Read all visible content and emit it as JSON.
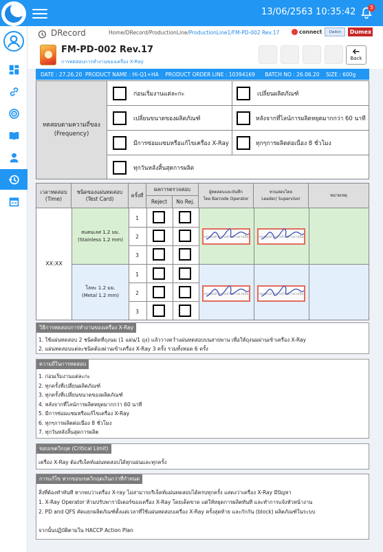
{
  "topbar": {
    "datetime": "13/06/2563 10:35:42",
    "notification_count": "5"
  },
  "header": {
    "brand": "DRecord",
    "breadcrumb_prefix": "Home/DRecord/ProductionLine/",
    "breadcrumb_current": "ProductionLine1/FM-PD-002 Rev.17",
    "partner_connect": "connect",
    "partner_daikin": "Daikin",
    "partner_dumex": "Dumex",
    "doc_title": "FM-PD-002 Rev.17",
    "doc_subtitle": "การทดสอบการทำงานของเครื่อง X-Ray",
    "back_label": "Back"
  },
  "infobar": {
    "date_label": "DATE :",
    "date": "27.26.20",
    "product_name_label": "PRODUCT NAME :",
    "product_name": "Hi-Q1+HA",
    "order_line_label": "PRODUCT ORDER LINE :",
    "order_line": "10394169",
    "batch_label": "BATCH NO :",
    "batch": "26.06.20",
    "size_label": "SIZE :",
    "size": "600g"
  },
  "frequency": {
    "label_th": "ทดสอบตามความถี่ของ",
    "label_en": "(Frequency)",
    "options": [
      "ก่อนเริ่มงานแต่ละกะ",
      "เปลี่ยนผลิตภัณฑ์",
      "เปลี่ยนขนาดของผลิตภัณฑ์",
      "หลังจากที่ไลน์การผลิตหยุดมากกว่า 60 นาที",
      "มีการซ่อมแซมหรือแก้ไขเครื่อง X-Ray",
      "ทุกๆการผลิตต่อเนื่อง 8  ชั่วโมง",
      "ทุกวันหลังสิ้นสุดการผลิต"
    ]
  },
  "table": {
    "headers": {
      "time_th": "เวลาทดสอบ",
      "time_en": "(Time)",
      "card_th": "ชนิดของแผ่นทดสอบ",
      "card_en": "(Test Card)",
      "round": "ครั้งที่",
      "result": "ผลการตรวจสอบ",
      "reject": "Reject",
      "no_rej": "No Rej.",
      "operator_th": "ผู้ทดสอบและบันทึก",
      "operator_en": "โดย Barcode Operator",
      "reviewer_th": "ทวนสอบโดย",
      "reviewer_en": "Leader/ Supervisor",
      "remark": "หมายเหตุ"
    },
    "time_value": "XX:XX",
    "groups": [
      {
        "card_th": "สแตนเลส 1.2 มม.",
        "card_en": "(Stainless 1.2 mm)",
        "rounds": [
          "1",
          "2",
          "3"
        ]
      },
      {
        "card_th": "โลหะ 1.2 มม.",
        "card_en": "(Metal 1.2 mm)",
        "rounds": [
          "1",
          "2",
          "3"
        ]
      }
    ],
    "stamp_text": "ทดสอบตัวอย่างตัวอย่างลายมือ"
  },
  "sections": {
    "method": {
      "title": "วิธีการทดสอบการทำงานของเครื่อง X-Ray",
      "lines": [
        "1. ใช้แผ่นทดสอบ 2 ชนิดติดที่ถุงนม (1 แผ่น/1 ถุง) แล้ววางคว่ำแผ่นทดสอบบนสายพาน เพื่อให้ถุงนมผ่านเข้าเครื่อง X-Ray",
        "2. แผ่นทดสอบแต่ละชนิดต้องผ่านเข้าเครื่อง X-Ray 3 ครั้ง รวมทั้งหมด 6 ครั้ง"
      ]
    },
    "frequency_detail": {
      "title": "ความถี่ในการทดสอบ",
      "lines": [
        "1. ก่อนเริ่มงานแต่ละกะ",
        "2. ทุกครั้งที่เปลี่ยนผลิตภัณฑ์",
        "3. ทุกครั้งที่เปลี่ยนขนาดของผลิตภัณฑ์",
        "4. หลังจากที่ไลน์การผลิตหยุดมากกว่า 60 นาที",
        "5. มีการซ่อมแซมหรือแก้ไขเครื่อง X-Ray",
        "6. ทุกๆการผลิตต่อเนื่อง 8  ชั่วโมง",
        "7. ทุกวันหลังสิ้นสุดการผลิต"
      ]
    },
    "critical": {
      "title": "ขอบเขตวิกฤต (Critical Limit)",
      "lines": [
        "เครื่อง X-Ray ต้องรีเจ็คท์แผ่นทดสอบได้ทุกแผ่นและทุกครั้ง"
      ]
    },
    "correction": {
      "title": "การแก้ไข หากขอบเขตวิกฤตเกินกว่าที่กำหนด",
      "lines": [
        "สิ่งที่ต้องทำทันที หากพบว่าเครื่อง X-ray ไม่สามารถรีเจ็คท์แผ่นทดสอบได้ครบทุกครั้ง แสดงว่าเครื่อง X-Ray มีปัญหา",
        "1. X-Ray Operator ห้ามปรับพารามิเตอร์ของเครื่อง X-Ray โดยเด็ดขาด แต่ให้หยุดการผลิตทันที และทำการแจ้งหัวหน้างาน",
        "2. PD and QFS คัดแยกผลิตภัณฑ์ตั้งแต่เวลาที่ใช้แผ่นทดสอบเครื่อง X-Ray ครั้งสุดท้าย และกักกัน (block) ผลิตภัณฑ์ในระบบ",
        "",
        "จากนั้นปฏิบัติตามใน HACCP Action Plan"
      ]
    }
  },
  "colors": {
    "primary": "#2196f3",
    "section_header": "#7b7b7b",
    "green_cell": "#d9efd3",
    "blue_cell": "#e3effb",
    "stamp_border": "#e36b5c",
    "badge": "#e53935"
  },
  "icons": {
    "logo": "app-logo-icon",
    "menu": "hamburger-icon",
    "bell": "bell-icon",
    "history": "history-icon",
    "back": "back-arrow-icon"
  }
}
